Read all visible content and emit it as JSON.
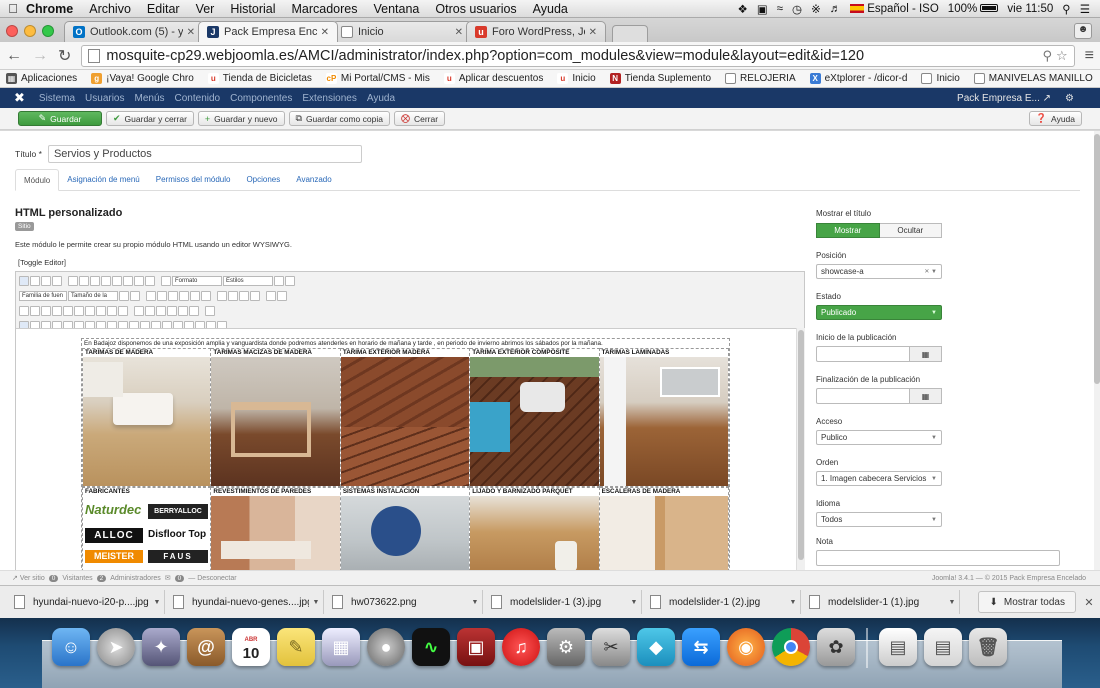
{
  "mac_menu": {
    "app": "Chrome",
    "items": [
      "Archivo",
      "Editar",
      "Ver",
      "Historial",
      "Marcadores",
      "Ventana",
      "Otros usuarios",
      "Ayuda"
    ],
    "input_source": "Español - ISO",
    "battery": "100%",
    "clock": "vie 11:50"
  },
  "tabs": [
    {
      "title": "Outlook.com (5) - yolanpr",
      "icon_color": "#0072c6",
      "icon_glyph": "O",
      "active": false
    },
    {
      "title": "Pack Empresa Encelado - A",
      "icon_color": "#1a3867",
      "icon_glyph": "J",
      "active": true
    },
    {
      "title": "Inicio",
      "icon_color": "#ffffff",
      "icon_glyph": "",
      "active": false
    },
    {
      "title": "Foro WordPress, Joomla y",
      "icon_color": "#d93a2b",
      "icon_glyph": "u",
      "active": false
    }
  ],
  "address": {
    "url": "mosquite-cp29.webjoomla.es/AMCI/administrator/index.php?option=com_modules&view=module&layout=edit&id=120"
  },
  "bookmarks": [
    {
      "label": "Aplicaciones",
      "icon": "apps-icon",
      "color": "#555555"
    },
    {
      "label": "¡Vaya! Google Chro",
      "icon": "folder-icon",
      "color": "#f0a030"
    },
    {
      "label": "Tienda de Bicicletas",
      "icon": "u-icon",
      "color": "#d93a2b"
    },
    {
      "label": "Mi Portal/CMS - Mis",
      "icon": "cp-icon",
      "color": "#f08a00"
    },
    {
      "label": "Aplicar descuentos",
      "icon": "u-icon",
      "color": "#d93a2b"
    },
    {
      "label": "Inicio",
      "icon": "u-icon",
      "color": "#d93a2b"
    },
    {
      "label": "Tienda Suplemento",
      "icon": "nm-icon",
      "color": "#b22222"
    },
    {
      "label": "RELOJERIA",
      "icon": "page-icon",
      "color": "#ffffff"
    },
    {
      "label": "eXtplorer - /dicor-d",
      "icon": "x-icon",
      "color": "#3a7bd5"
    },
    {
      "label": "Inicio",
      "icon": "page-icon",
      "color": "#ffffff"
    },
    {
      "label": "MANIVELAS MANILLO",
      "icon": "page-icon",
      "color": "#ffffff"
    }
  ],
  "joomla_nav": {
    "items": [
      "Sistema",
      "Usuarios",
      "Menús",
      "Contenido",
      "Componentes",
      "Extensiones",
      "Ayuda"
    ],
    "site_name": "Pack Empresa E..."
  },
  "toolbar": {
    "save": "Guardar",
    "save_close": "Guardar y cerrar",
    "save_new": "Guardar y nuevo",
    "save_copy": "Guardar como copia",
    "close": "Cerrar",
    "help": "Ayuda"
  },
  "form": {
    "title_label": "Título *",
    "title_value": "Servios y Productos",
    "tabs": [
      "Módulo",
      "Asignación de menú",
      "Permisos del módulo",
      "Opciones",
      "Avanzado"
    ],
    "module_type": "HTML personalizado",
    "badge": "Sitio",
    "description": "Este módulo le permite crear su propio módulo HTML usando un editor WYSIWYG.",
    "toggle_editor": "[Toggle Editor]",
    "toolbar_selects": [
      "Formato",
      "Estilos",
      "Familia de fuen",
      "Tamaño de la"
    ]
  },
  "editor_content": {
    "intro": "En Badajoz disponemos de una exposición amplia y vanguardista donde podremos atenderles en horario de mañana y tarde , en periodo de invierno abrimos los sábados por la mañana.",
    "row1": [
      "TARIMAS DE MADERA",
      "TARIMAS MACIZAS DE MADERA",
      "TARIMA EXTERIOR MADERA",
      "TARIMA EXTERIOR COMPOSITE",
      "TARIMAS LAMINADAS"
    ],
    "row2": [
      "FABRICANTES",
      "REVESTIMIENTOS DE PAREDES",
      "SISTEMAS  INSTALACION",
      "LIJADO Y BARNIZADO PARQUET",
      "ESCALERAS DE MADERA"
    ],
    "brands": [
      "Naturdec",
      "BERRYALLOC",
      "ALLOC",
      "Disfloor Top",
      "MEISTER",
      "FAUS"
    ]
  },
  "sidebar": {
    "show_title_label": "Mostrar el título",
    "show": "Mostrar",
    "hide": "Ocultar",
    "position_label": "Posición",
    "position_value": "showcase-a",
    "status_label": "Estado",
    "status_value": "Publicado",
    "start_label": "Inicio de la publicación",
    "end_label": "Finalización de la publicación",
    "access_label": "Acceso",
    "access_value": "Publico",
    "order_label": "Orden",
    "order_value": "1. Imagen cabecera Servicios",
    "language_label": "Idioma",
    "language_value": "Todos",
    "note_label": "Nota"
  },
  "status_bar": {
    "view_site": "Ver sitio",
    "visitors_count": "0",
    "visitors": "Visitantes",
    "admins_count": "2",
    "admins": "Administradores",
    "messages_count": "0",
    "logout": "Desconectar",
    "version": "Joomla! 3.4.1  —  © 2015 Pack Empresa Encelado"
  },
  "downloads": {
    "files": [
      "hyundai-nuevo-i20-p....jpg",
      "hyundai-nuevo-genes....jpg",
      "hw073622.png",
      "modelslider-1 (3).jpg",
      "modelslider-1 (2).jpg",
      "modelslider-1 (1).jpg"
    ],
    "show_all": "Mostrar todas"
  },
  "dock": {
    "calendar_month": "ABR",
    "calendar_day": "10"
  }
}
